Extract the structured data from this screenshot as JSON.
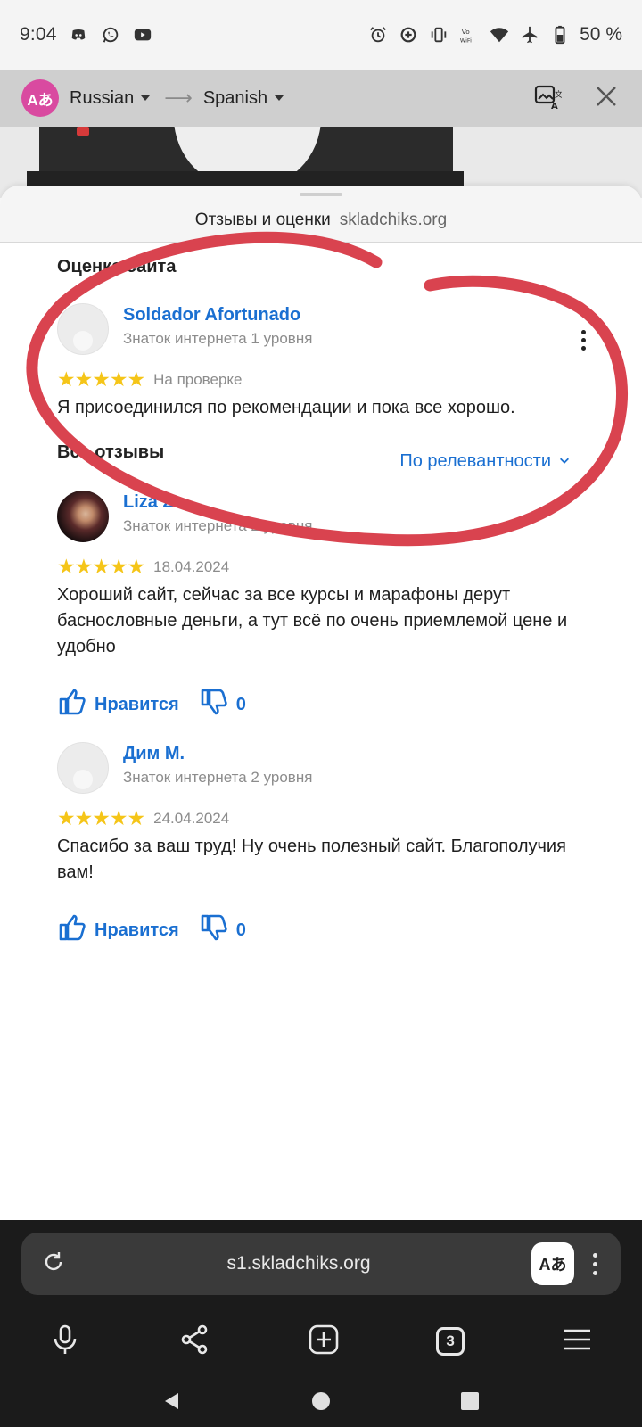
{
  "status_bar": {
    "time": "9:04",
    "battery": "50 %"
  },
  "translate_bar": {
    "source_lang": "Russian",
    "target_lang": "Spanish",
    "logo_text": "Aあ"
  },
  "sheet": {
    "title": "Отзывы и оценки",
    "domain": "skladchiks.org"
  },
  "site_rating": {
    "section_title": "Оценка сайта",
    "review": {
      "name": "Soldador Afortunado",
      "level": "Знаток интернета 1 уровня",
      "stars": 5,
      "status": "На проверке",
      "text": "Я присоединился по рекомендации и пока все хорошо."
    }
  },
  "all_reviews": {
    "section_title": "Все отзывы",
    "sort_label": "По релевантности",
    "items": [
      {
        "name": "Liza Z.",
        "level": "Знаток интернета 2 уровня",
        "stars": 5,
        "date": "18.04.2024",
        "text": "Хороший сайт, сейчас за все курсы и марафоны дерут баснословные деньги, а тут всё по очень приемлемой цене и удобно",
        "like_label": "Нравится",
        "dislike_count": "0"
      },
      {
        "name": "Дим М.",
        "level": "Знаток интернета 2 уровня",
        "stars": 5,
        "date": "24.04.2024",
        "text": "Спасибо за ваш труд! Ну очень полезный сайт. Благополучия вам!",
        "like_label": "Нравится",
        "dislike_count": "0"
      }
    ]
  },
  "browser": {
    "url": "s1.skladchiks.org",
    "tab_count": "3",
    "translate_button_text": "Aあ"
  },
  "colors": {
    "link_blue": "#1a6fd1",
    "star_yellow": "#f5c518",
    "annotation_red": "#d9434f"
  }
}
